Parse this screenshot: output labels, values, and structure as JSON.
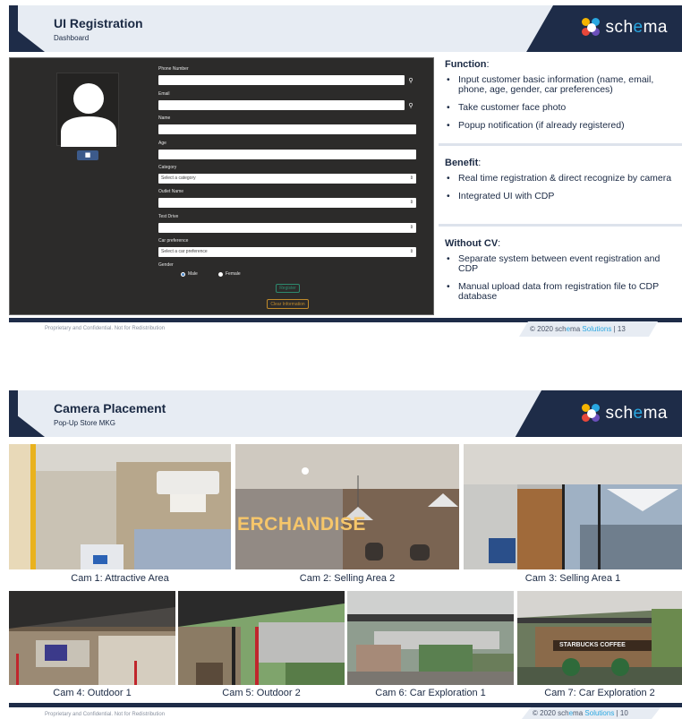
{
  "slide1": {
    "title": "UI Registration",
    "subtitle": "Dashboard",
    "logo": "schema",
    "form": {
      "phone_label": "Phone Number",
      "email_label": "Email",
      "name_label": "Name",
      "age_label": "Age",
      "category_label": "Category",
      "category_placeholder": "Select a category",
      "outlet_label": "Outlet Name",
      "testdrive_label": "Test Drive",
      "carpref_label": "Car preference",
      "carpref_placeholder": "Select a car preference",
      "gender_label": "Gender",
      "gender_male": "Male",
      "gender_female": "Female",
      "register_label": "Register",
      "clear_label": "Clear Information"
    },
    "function": {
      "heading": "Function",
      "items": [
        "Input customer basic information (name, email, phone, age, gender, car preferences)",
        "Take customer face photo",
        "Popup notification (if already registered)"
      ]
    },
    "benefit": {
      "heading": "Benefit",
      "items": [
        "Real time registration & direct recognize by camera",
        "Integrated UI with CDP"
      ]
    },
    "without_cv": {
      "heading": "Without CV",
      "items": [
        "Separate system between event registration and CDP",
        "Manual upload data from registration file to CDP database"
      ]
    },
    "footer_left": "Proprietary and Confidential. Not for Redistribution",
    "footer_copy": "© 2020 sch",
    "footer_e": "e",
    "footer_ma": "ma",
    "footer_solutions": "Solutions",
    "footer_page": "| 13"
  },
  "slide2": {
    "title": "Camera Placement",
    "subtitle": "Pop-Up Store MKG",
    "logo": "schema",
    "cams": [
      "Cam 1: Attractive Area",
      "Cam 2: Selling Area 2",
      "Cam 3: Selling Area 1",
      "Cam 4: Outdoor 1",
      "Cam 5: Outdoor 2",
      "Cam 6: Car Exploration 1",
      "Cam 7: Car Exploration 2"
    ],
    "sign_merch": "ERCHANDISE",
    "sign_starbucks": "STARBUCKS COFFEE",
    "footer_left": "Proprietary and Confidential. Not for Redistribution",
    "footer_copy": "© 2020 sch",
    "footer_e": "e",
    "footer_ma": "ma",
    "footer_solutions": "Solutions",
    "footer_page": "| 10"
  },
  "colors": {
    "navy": "#1e2c48",
    "light_band": "#e7ecf3",
    "accent": "#29a7e1",
    "panel": "#2c2b2a"
  }
}
